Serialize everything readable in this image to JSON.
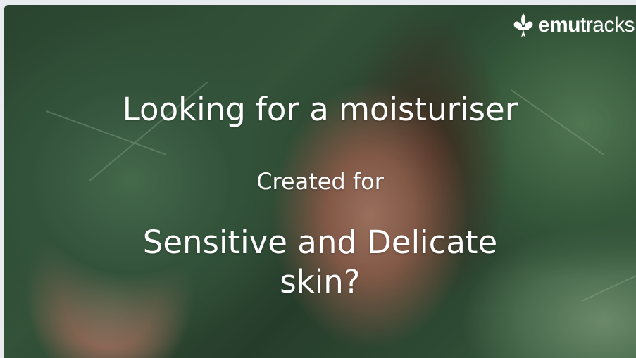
{
  "brand": {
    "logo_icon": "fleur-de-lis-icon",
    "name_part1": "emu",
    "name_part2": "tracks"
  },
  "ad": {
    "headline": "Looking for a moisturiser",
    "subheadline": "Created for",
    "tagline_line1": "Sensitive and Delicate",
    "tagline_line2": "skin?"
  },
  "colors": {
    "text": "#ffffff",
    "leaf_green": "#3c6543"
  }
}
